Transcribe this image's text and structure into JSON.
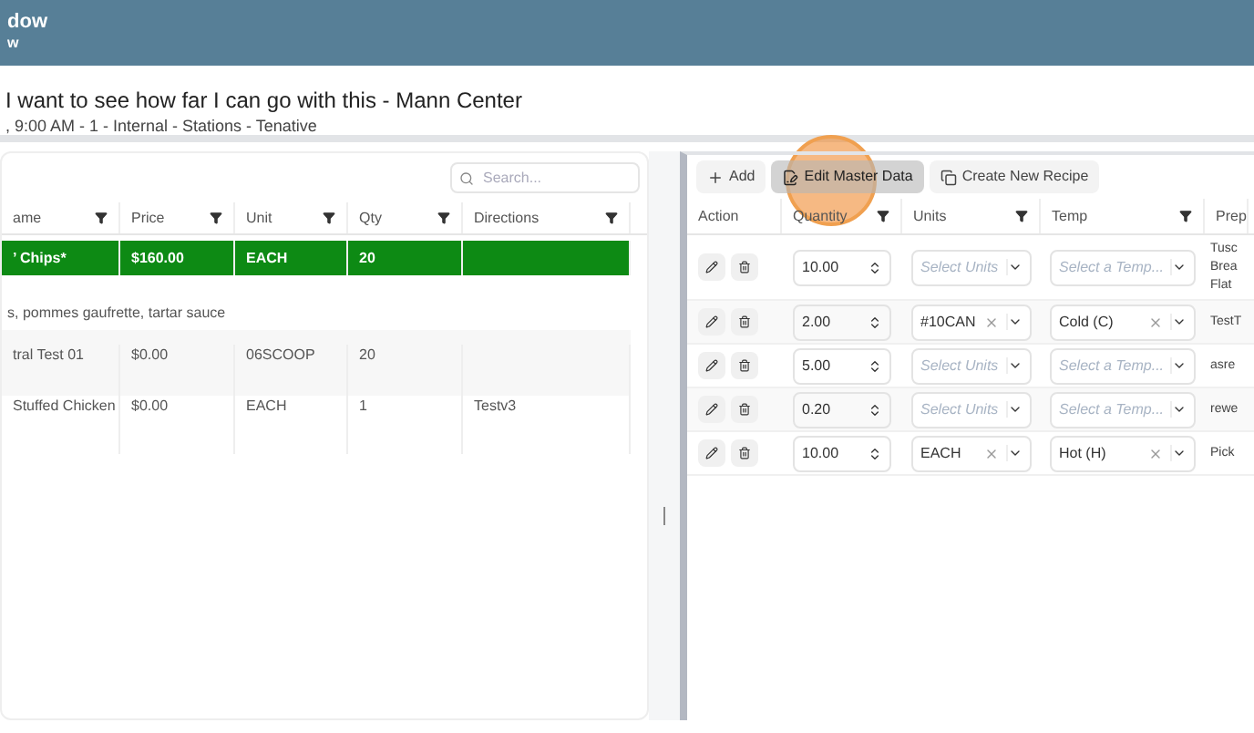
{
  "header": {
    "title": "dow",
    "subtitle": "w"
  },
  "event": {
    "title": "I want to see how far I can go with this - Mann Center",
    "details": ", 9:00 AM - 1 - Internal - Stations - Tenative"
  },
  "left_table": {
    "search": {
      "placeholder": "Search..."
    },
    "columns": [
      "ame",
      "Price",
      "Unit",
      "Qty",
      "Directions"
    ],
    "rows": [
      {
        "cells": [
          "’ Chips*",
          "$160.00",
          "EACH",
          "20",
          ""
        ],
        "selected": true,
        "note": "s, pommes gaufrette, tartar sauce"
      },
      {
        "cells": [
          "tral Test 01",
          "$0.00",
          "06SCOOP",
          "20",
          ""
        ],
        "selected": false
      },
      {
        "cells": [
          "Stuffed Chicken",
          "$0.00",
          "EACH",
          "1",
          "Testv3"
        ],
        "selected": false
      }
    ]
  },
  "right_panel": {
    "toolbar": [
      {
        "label": "Add",
        "kind": "add",
        "selected": false
      },
      {
        "label": "Edit Master Data",
        "kind": "edit",
        "selected": true
      },
      {
        "label": "Create New Recipe",
        "kind": "copy",
        "selected": false
      }
    ],
    "columns": [
      "Action",
      "Quantity",
      "Units",
      "Temp",
      "Prep"
    ],
    "rows": [
      {
        "quantity": "10.00",
        "units": {
          "placeholder": "Select Units"
        },
        "temp": {
          "placeholder": "Select a Temp..."
        },
        "prep": [
          "Tusc",
          "Brea",
          "Flat"
        ]
      },
      {
        "quantity": "2.00",
        "units": {
          "value": "#10CAN"
        },
        "temp": {
          "value": "Cold (C)"
        },
        "prep": [
          "TestT"
        ]
      },
      {
        "quantity": "5.00",
        "units": {
          "placeholder": "Select Units"
        },
        "temp": {
          "placeholder": "Select a Temp..."
        },
        "prep": [
          "asre"
        ]
      },
      {
        "quantity": "0.20",
        "units": {
          "placeholder": "Select Units"
        },
        "temp": {
          "placeholder": "Select a Temp..."
        },
        "prep": [
          "rewe"
        ]
      },
      {
        "quantity": "10.00",
        "units": {
          "value": "EACH"
        },
        "temp": {
          "value": "Hot (H)"
        },
        "prep": [
          "Pick"
        ]
      }
    ]
  }
}
